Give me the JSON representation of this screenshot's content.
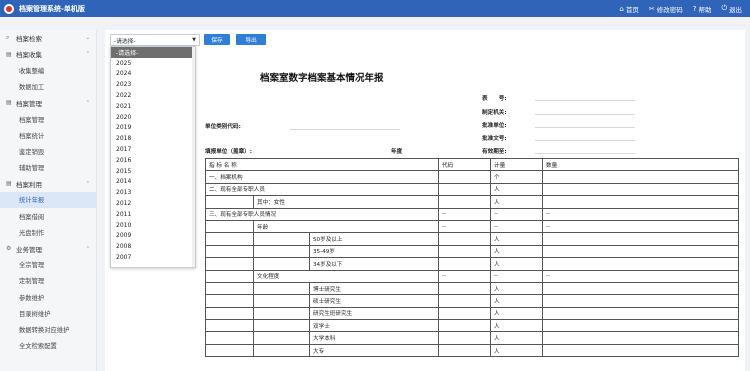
{
  "app": {
    "title": "档案管理系统-单机版"
  },
  "topnav": {
    "home": "首页",
    "change_password": "修改密码",
    "help": "帮助",
    "logout": "退出"
  },
  "sidebar": {
    "groups": [
      {
        "label": "档案检索",
        "icon": "search-icon",
        "items": []
      },
      {
        "label": "档案收集",
        "icon": "folder-icon",
        "items": [
          "收集整编",
          "数据加工"
        ]
      },
      {
        "label": "档案管理",
        "icon": "folder-icon",
        "items": [
          "档案管理",
          "档案统计",
          "鉴定销毁",
          "辅助管理"
        ]
      },
      {
        "label": "档案利用",
        "icon": "folder-icon",
        "items": [
          "统计年报",
          "档案借阅",
          "光盘制作"
        ]
      },
      {
        "label": "业务管理",
        "icon": "gear-icon",
        "items": [
          "全宗管理",
          "定制管理",
          "参数维护",
          "目录树维护",
          "数据转换对应维护",
          "全文检索配置"
        ]
      }
    ],
    "active_item": "统计年报"
  },
  "toolbar": {
    "year_select_value": "-请选择-",
    "save_label": "保存",
    "export_label": "导出"
  },
  "year_dropdown": {
    "options": [
      "-请选择-",
      "2025",
      "2024",
      "2023",
      "2022",
      "2021",
      "2020",
      "2019",
      "2018",
      "2017",
      "2016",
      "2015",
      "2014",
      "2013",
      "2012",
      "2011",
      "2010",
      "2009",
      "2008",
      "2007"
    ],
    "highlighted": "-请选择-"
  },
  "report": {
    "title": "档案室数字档案基本情况年报",
    "right_labels": [
      "表　　号:",
      "制定机关:",
      "批准单位:",
      "批准文号:",
      "有效期至:"
    ],
    "unit_code_label": "单位类别代码:",
    "fill_unit_label": "填报单位（盖章）:",
    "year_label": "年度",
    "table": {
      "headers": [
        "指 标 名 称",
        "代码",
        "计量",
        "数量"
      ],
      "rows": [
        {
          "c1": "一、档案机构",
          "c2": "",
          "c3": "",
          "code": "",
          "unit": "个",
          "qty": ""
        },
        {
          "c1": "二、现有全部专职人员",
          "c2": "",
          "c3": "",
          "code": "",
          "unit": "人",
          "qty": ""
        },
        {
          "c1": "",
          "c2": "其中：女性",
          "c3": "",
          "code": "",
          "unit": "人",
          "qty": ""
        },
        {
          "c1": "三、现有全部专职人员情况",
          "c2": "",
          "c3": "",
          "code": "--",
          "unit": "--",
          "qty": "--"
        },
        {
          "c1": "",
          "c2": "年龄",
          "c3": "",
          "code": "--",
          "unit": "--",
          "qty": "--"
        },
        {
          "c1": "",
          "c2": "",
          "c3": "50岁及以上",
          "code": "",
          "unit": "人",
          "qty": ""
        },
        {
          "c1": "",
          "c2": "",
          "c3": "35-49岁",
          "code": "",
          "unit": "人",
          "qty": ""
        },
        {
          "c1": "",
          "c2": "",
          "c3": "34岁及以下",
          "code": "",
          "unit": "人",
          "qty": ""
        },
        {
          "c1": "",
          "c2": "文化程度",
          "c3": "",
          "code": "--",
          "unit": "--",
          "qty": "--"
        },
        {
          "c1": "",
          "c2": "",
          "c3": "博士研究生",
          "code": "",
          "unit": "人",
          "qty": ""
        },
        {
          "c1": "",
          "c2": "",
          "c3": "硕士研究生",
          "code": "",
          "unit": "人",
          "qty": ""
        },
        {
          "c1": "",
          "c2": "",
          "c3": "研究生班研究生",
          "code": "",
          "unit": "人",
          "qty": ""
        },
        {
          "c1": "",
          "c2": "",
          "c3": "双学士",
          "code": "",
          "unit": "人",
          "qty": ""
        },
        {
          "c1": "",
          "c2": "",
          "c3": "大学本科",
          "code": "",
          "unit": "人",
          "qty": ""
        },
        {
          "c1": "",
          "c2": "",
          "c3": "大专",
          "code": "",
          "unit": "人",
          "qty": ""
        }
      ]
    }
  }
}
